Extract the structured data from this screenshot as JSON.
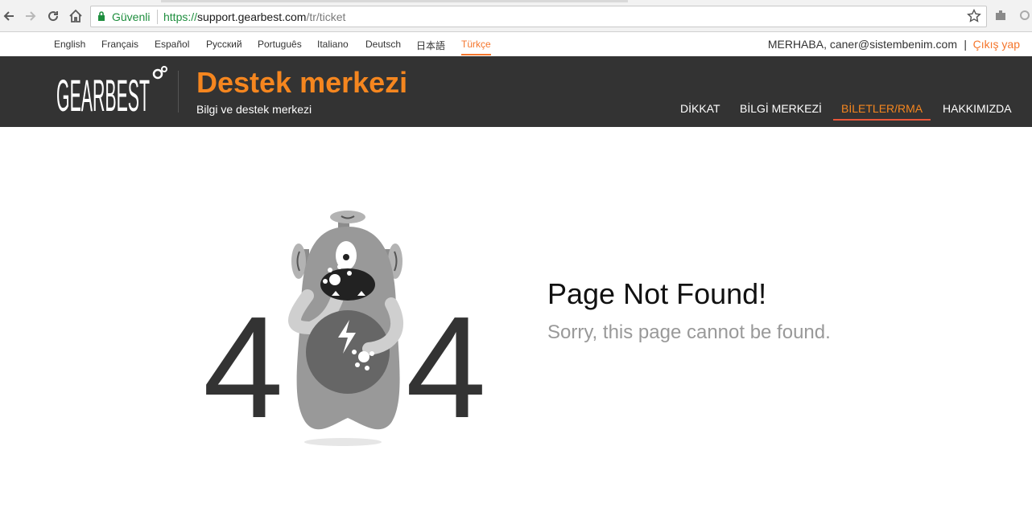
{
  "browser": {
    "secure_label": "Güvenli",
    "url_scheme": "https://",
    "url_host": "support.gearbest.com",
    "url_path": "/tr/ticket"
  },
  "languages": [
    {
      "label": "English"
    },
    {
      "label": "Français"
    },
    {
      "label": "Español"
    },
    {
      "label": "Русский"
    },
    {
      "label": "Português"
    },
    {
      "label": "Italiano"
    },
    {
      "label": "Deutsch"
    },
    {
      "label": "日本語"
    },
    {
      "label": "Türkçe",
      "active": true
    }
  ],
  "user": {
    "greeting": "MERHABA, caner@sistembenim.com",
    "separator": "|",
    "logout_label": "Çıkış yap"
  },
  "header": {
    "logo_text": "GEARBEST",
    "title": "Destek merkezi",
    "subtitle": "Bilgi ve destek merkezi",
    "nav": [
      {
        "label": "DİKKAT"
      },
      {
        "label": "BİLGİ MERKEZİ"
      },
      {
        "label": "BİLETLER/RMA",
        "active": true
      },
      {
        "label": "HAKKIMIZDA"
      }
    ]
  },
  "error": {
    "digit_left": "4",
    "digit_right": "4",
    "title": "Page Not Found!",
    "message": "Sorry, this page cannot be found."
  },
  "colors": {
    "accent": "#f5861f",
    "header_bg": "#333333",
    "active_underline": "#e8563a"
  }
}
